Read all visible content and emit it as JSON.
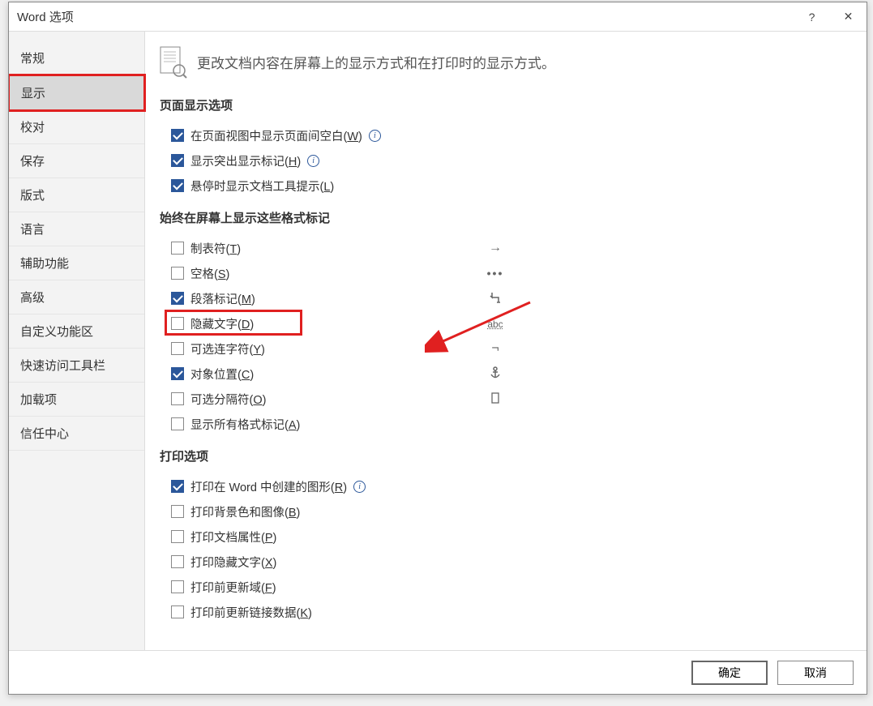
{
  "title": "Word 选项",
  "titlebar": {
    "help": "?",
    "close": "✕"
  },
  "sidebar": [
    {
      "label": "常规"
    },
    {
      "label": "显示",
      "selected": true
    },
    {
      "label": "校对"
    },
    {
      "label": "保存"
    },
    {
      "label": "版式"
    },
    {
      "label": "语言"
    },
    {
      "label": "辅助功能"
    },
    {
      "label": "高级"
    },
    {
      "label": "自定义功能区"
    },
    {
      "label": "快速访问工具栏"
    },
    {
      "label": "加载项"
    },
    {
      "label": "信任中心"
    }
  ],
  "intro": "更改文档内容在屏幕上的显示方式和在打印时的显示方式。",
  "sections": {
    "page_display": {
      "title": "页面显示选项",
      "items": [
        {
          "label": "在页面视图中显示页面间空白(",
          "accel": "W",
          "tail": ")",
          "checked": true,
          "info": true
        },
        {
          "label": "显示突出显示标记(",
          "accel": "H",
          "tail": ")",
          "checked": true,
          "info": true
        },
        {
          "label": "悬停时显示文档工具提示(",
          "accel": "L",
          "tail": ")",
          "checked": true,
          "info": false
        }
      ]
    },
    "format_marks": {
      "title": "始终在屏幕上显示这些格式标记",
      "items": [
        {
          "label": "制表符(",
          "accel": "T",
          "tail": ")",
          "checked": false,
          "mark": "tab"
        },
        {
          "label": "空格(",
          "accel": "S",
          "tail": ")",
          "checked": false,
          "mark": "dots"
        },
        {
          "label": "段落标记(",
          "accel": "M",
          "tail": ")",
          "checked": true,
          "mark": "pilcrow"
        },
        {
          "label": "隐藏文字(",
          "accel": "D",
          "tail": ")",
          "checked": false,
          "mark": "abc",
          "highlight": true
        },
        {
          "label": "可选连字符(",
          "accel": "Y",
          "tail": ")",
          "checked": false,
          "mark": "neg"
        },
        {
          "label": "对象位置(",
          "accel": "C",
          "tail": ")",
          "checked": true,
          "mark": "anchor"
        },
        {
          "label": "可选分隔符(",
          "accel": "O",
          "tail": ")",
          "checked": false,
          "mark": "optbreak"
        },
        {
          "label": "显示所有格式标记(",
          "accel": "A",
          "tail": ")",
          "checked": false,
          "mark": ""
        }
      ]
    },
    "print": {
      "title": "打印选项",
      "items": [
        {
          "label": "打印在 Word 中创建的图形(",
          "accel": "R",
          "tail": ")",
          "checked": true,
          "info": true
        },
        {
          "label": "打印背景色和图像(",
          "accel": "B",
          "tail": ")",
          "checked": false,
          "info": false
        },
        {
          "label": "打印文档属性(",
          "accel": "P",
          "tail": ")",
          "checked": false,
          "info": false
        },
        {
          "label": "打印隐藏文字(",
          "accel": "X",
          "tail": ")",
          "checked": false,
          "info": false
        },
        {
          "label": "打印前更新域(",
          "accel": "F",
          "tail": ")",
          "checked": false,
          "info": false
        },
        {
          "label": "打印前更新链接数据(",
          "accel": "K",
          "tail": ")",
          "checked": false,
          "info": false
        }
      ]
    }
  },
  "buttons": {
    "ok": "确定",
    "cancel": "取消"
  }
}
